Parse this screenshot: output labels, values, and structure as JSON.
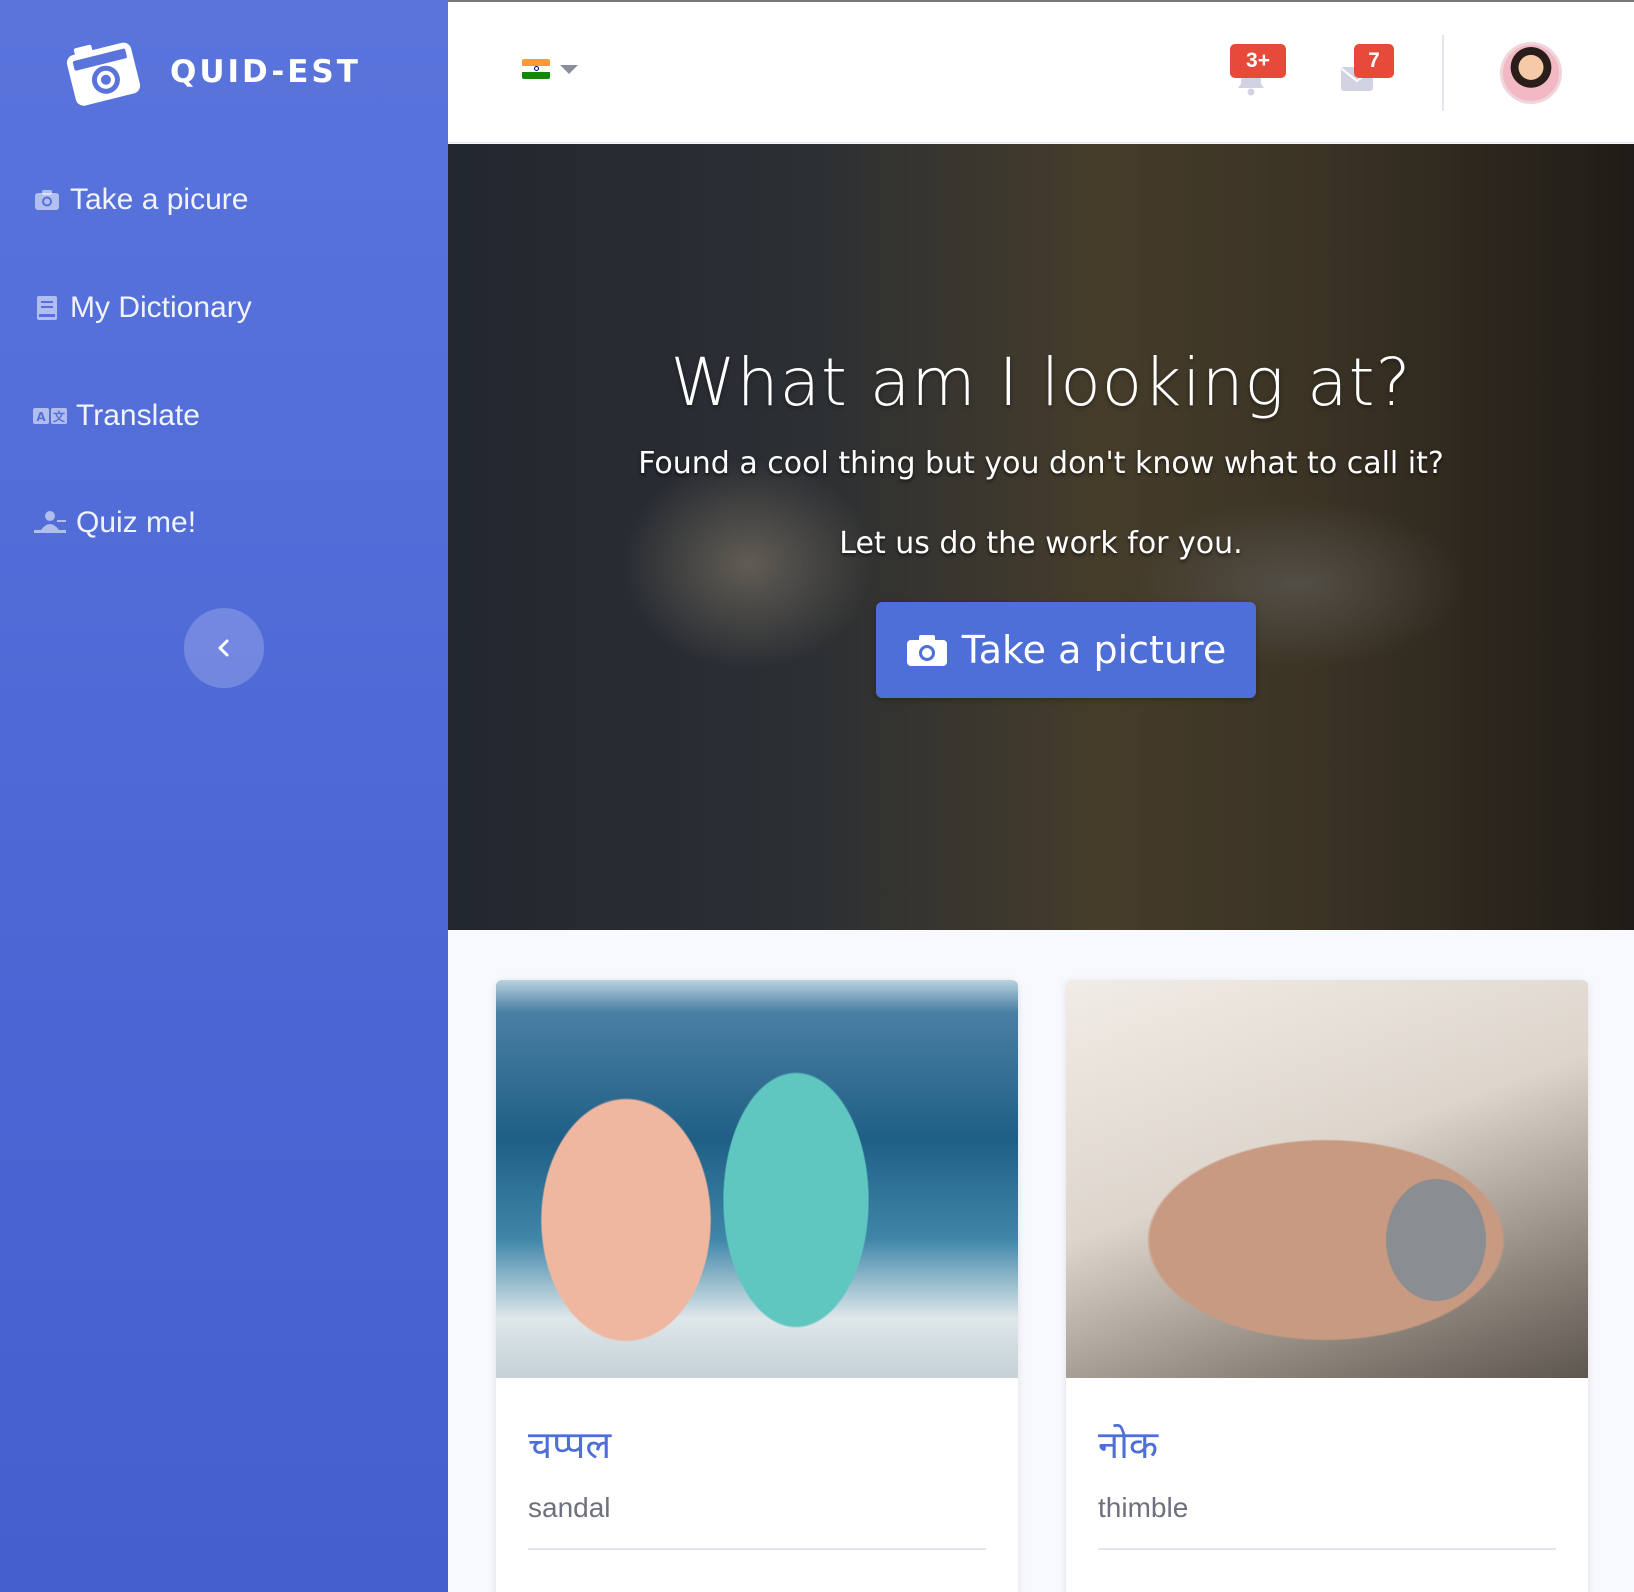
{
  "brand": {
    "name": "QUID-EST"
  },
  "sidebar": {
    "items": [
      {
        "label": "Take a picure",
        "icon": "camera-icon"
      },
      {
        "label": "My Dictionary",
        "icon": "book-icon"
      },
      {
        "label": "Translate",
        "icon": "language-icon"
      },
      {
        "label": "Quiz me!",
        "icon": "chalkboard-teacher-icon"
      }
    ],
    "collapse_icon": "chevron-left-icon"
  },
  "topbar": {
    "language": {
      "flag": "india-flag-icon"
    },
    "alerts": {
      "icon": "bell-icon",
      "badge": "3+"
    },
    "messages": {
      "icon": "envelope-icon",
      "badge": "7"
    },
    "user": {
      "avatar": "user-avatar"
    }
  },
  "hero": {
    "title": "What am I looking at?",
    "subtitle1": "Found a cool thing but you don't know what to call it?",
    "subtitle2": "Let us do the work for you.",
    "button_label": "Take a picture"
  },
  "cards": [
    {
      "word": "चप्पल",
      "translation": "sandal"
    },
    {
      "word": "नोक",
      "translation": "thimble"
    }
  ],
  "colors": {
    "primary": "#4e6ed8",
    "sidebar": "#4b67d4",
    "badge": "#e74a3b",
    "muted_text": "#6e707e"
  }
}
